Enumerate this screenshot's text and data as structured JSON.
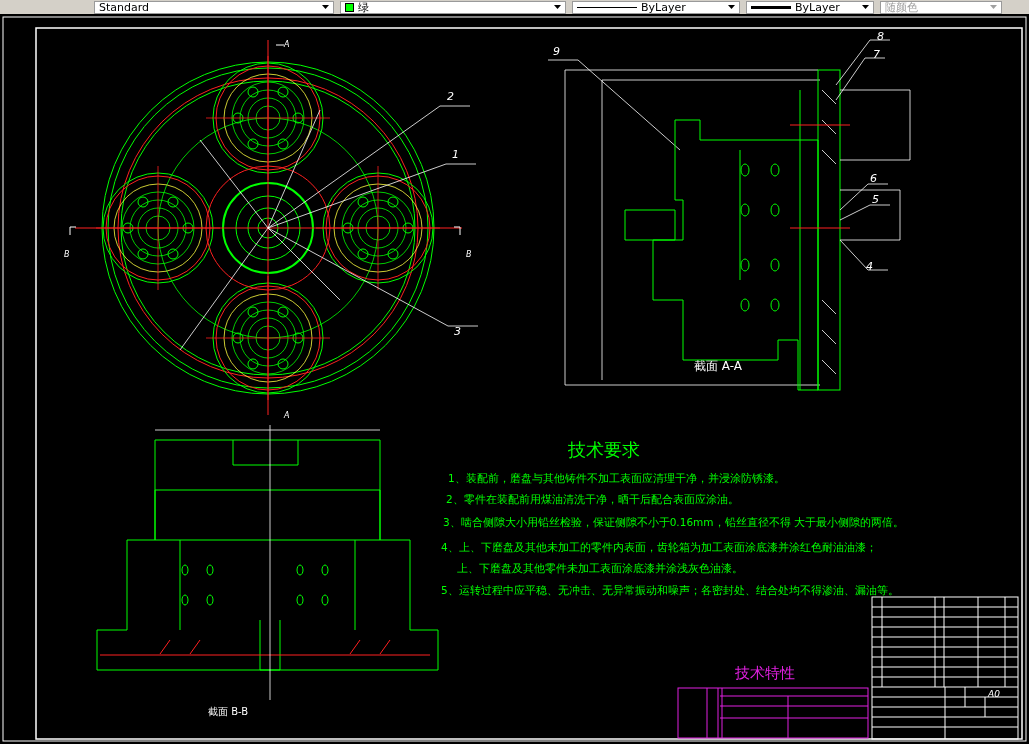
{
  "toolbar": {
    "items": [
      {
        "kind": "style",
        "label": "Standard"
      },
      {
        "kind": "color",
        "label": "绿",
        "color": "#00ff00"
      },
      {
        "kind": "linetype",
        "label": "ByLayer"
      },
      {
        "kind": "lineweight",
        "label": "ByLayer"
      },
      {
        "kind": "plotstyle",
        "label": "随颜色",
        "disabled": true
      }
    ]
  },
  "drawing": {
    "part_labels": [
      "8",
      "9",
      "7",
      "2",
      "1",
      "6",
      "5",
      "4",
      "3"
    ],
    "section_markers": [
      "A",
      "A",
      "B",
      "B"
    ],
    "section_titles": [
      "截面 A-A",
      "截面 B-B"
    ],
    "technical_requirements": {
      "title": "技术要求",
      "lines": [
        "1、装配前，磨盘与其他铸件不加工表面应清理干净，并浸涂防锈漆。",
        "2、零件在装配前用煤油清洗干净，晒干后配合表面应涂油。",
        "3、啮合侧隙大小用铅丝检验，保证侧隙不小于0.16mm，铅丝直径不得 大于最小侧隙的两倍。",
        "4、上、下磨盘及其他未加工的零件内表面，齿轮箱为加工表面涂底漆并涂红色耐油油漆；",
        "上、下磨盘及其他零件未加工表面涂底漆并涂浅灰色油漆。",
        "5、运转过程中应平稳、无冲击、无异常振动和噪声；各密封处、结合处均不得渗油、漏油等。"
      ]
    },
    "technical_characteristics": {
      "title": "技术特性"
    },
    "title_block": {
      "sheet_size": "A0"
    }
  }
}
